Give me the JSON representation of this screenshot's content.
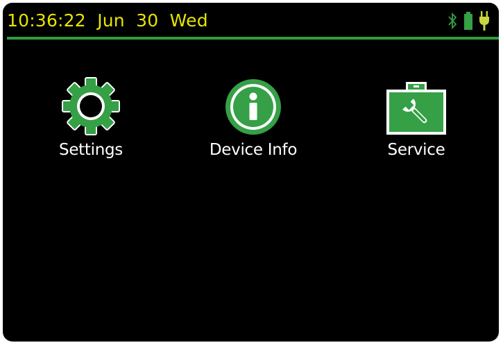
{
  "status_bar": {
    "time": "10:36:22",
    "date": "Jun  30",
    "weekday": "Wed",
    "text_color": "#e6e600",
    "divider_color": "#2e9e3e",
    "icons": [
      "bluetooth-icon",
      "battery-icon",
      "power-plug-icon"
    ]
  },
  "apps": [
    {
      "label": "Settings",
      "icon": "gear-icon"
    },
    {
      "label": "Device Info",
      "icon": "info-icon"
    },
    {
      "label": "Service",
      "icon": "wrench-toolbox-icon"
    }
  ],
  "colors": {
    "background": "#000000",
    "accent_green": "#35a046",
    "dark_green": "#145a23",
    "label_text": "#ffffff"
  }
}
